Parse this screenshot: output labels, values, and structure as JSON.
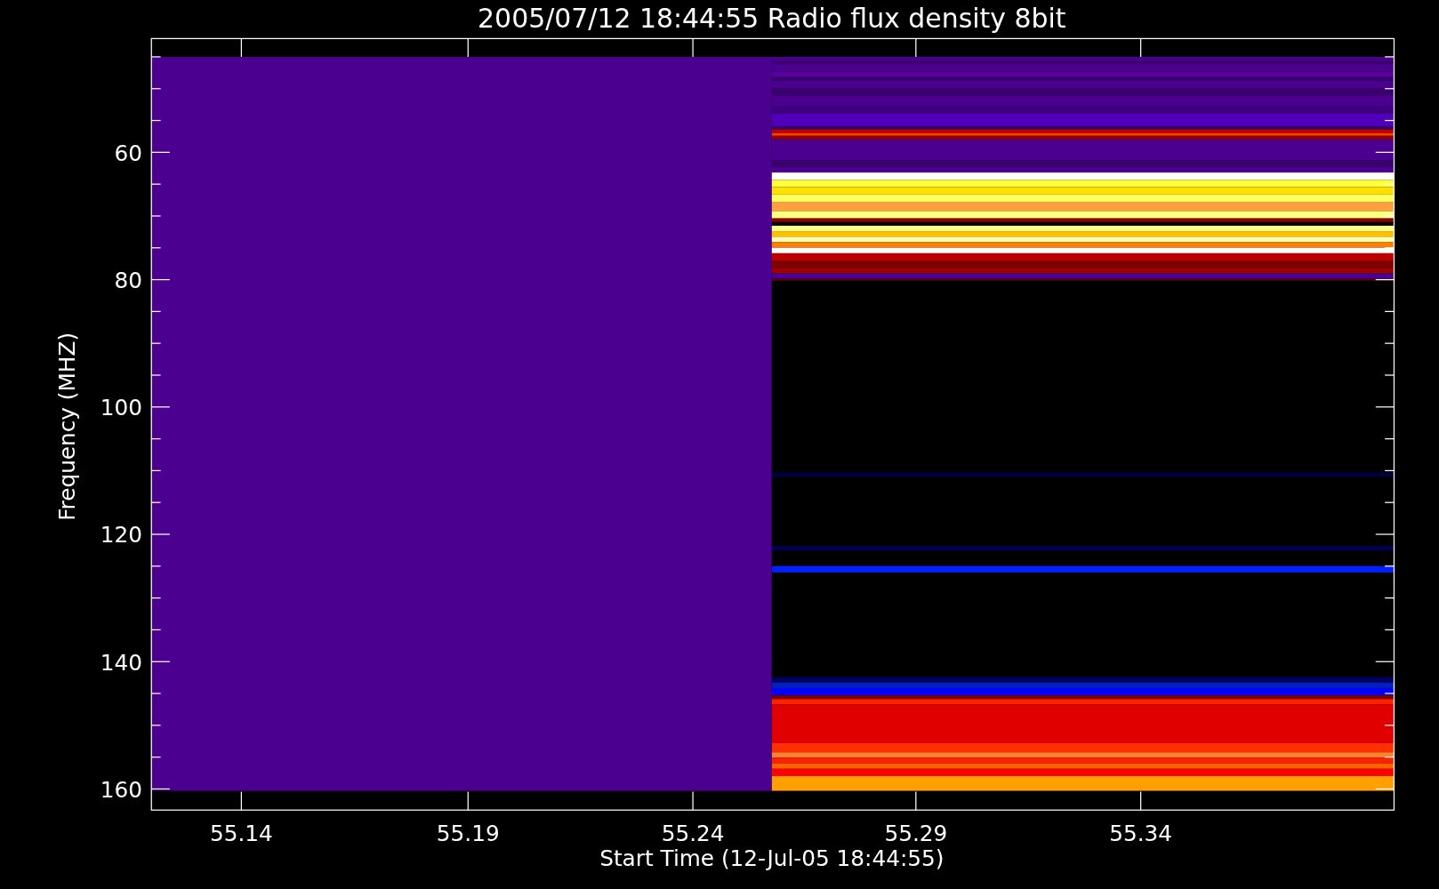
{
  "plot": {
    "title": "2005/07/12 18:44:55 Radio flux density 8bit",
    "xlabel": "Start Time (12-Jul-05 18:44:55)",
    "ylabel": "Frequency (MHZ)",
    "xticks": [
      "55.14",
      "55.19",
      "55.24",
      "55.29",
      "55.34"
    ],
    "yticks": [
      "60",
      "80",
      "100",
      "120",
      "140",
      "160"
    ]
  }
}
